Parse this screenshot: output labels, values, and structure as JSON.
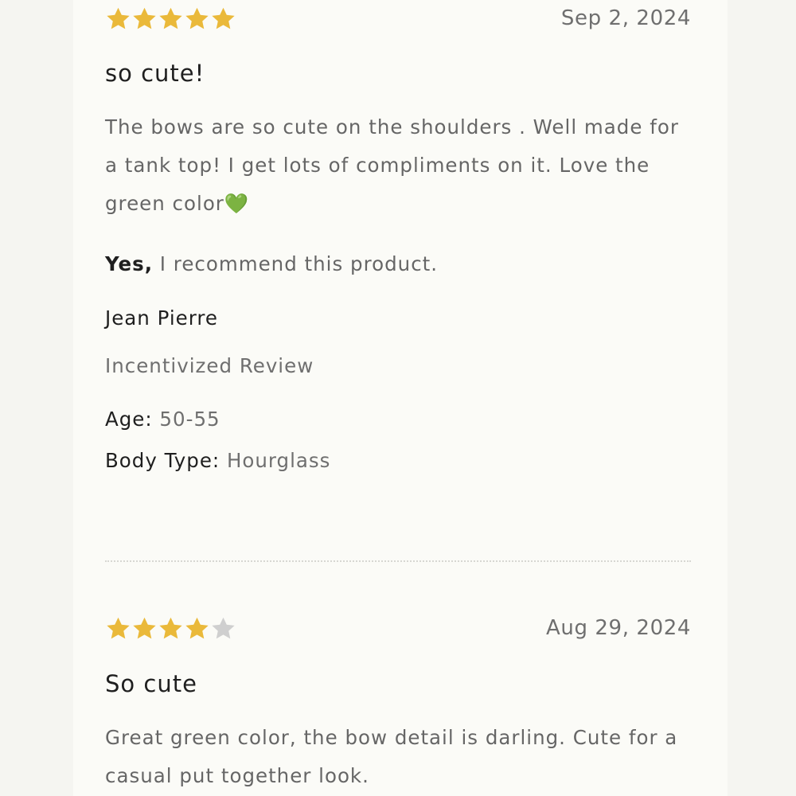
{
  "colors": {
    "star_filled": "#eab93a",
    "star_empty": "#cfcfcf",
    "page_background": "#f5f5f1",
    "panel_background": "#fbfbf7"
  },
  "reviews": [
    {
      "rating": 5,
      "max_rating": 5,
      "date": "Sep 2, 2024",
      "title": "so cute!",
      "body": "The bows are so cute on the shoulders . Well made for a tank top! I get lots of compliments on it. Love the green color",
      "body_emoji": "💚",
      "recommend_yes": "Yes,",
      "recommend_text": " I recommend this product.",
      "reviewer": "Jean Pierre",
      "badge": "Incentivized Review",
      "age_label": "Age:",
      "age_value": " 50-55",
      "body_type_label": "Body Type:",
      "body_type_value": " Hourglass"
    },
    {
      "rating": 4,
      "max_rating": 5,
      "date": "Aug 29, 2024",
      "title": "So cute",
      "body": "Great green color, the bow detail is darling. Cute for a casual put together look."
    }
  ]
}
